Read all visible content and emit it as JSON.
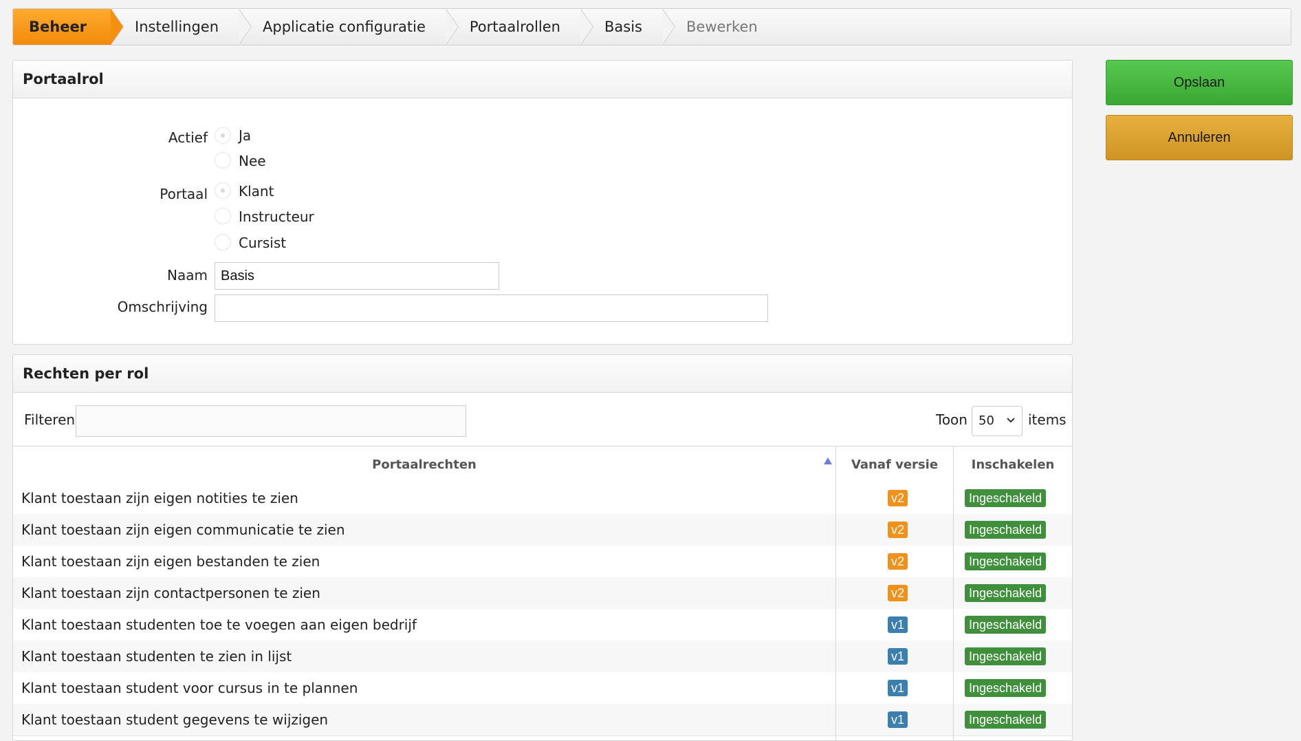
{
  "breadcrumb": [
    "Beheer",
    "Instellingen",
    "Applicatie configuratie",
    "Portaalrollen",
    "Basis",
    "Bewerken"
  ],
  "buttons": {
    "save": "Opslaan",
    "cancel": "Annuleren"
  },
  "form": {
    "title": "Portaalrol",
    "actief_label": "Actief",
    "actief_options": [
      "Ja",
      "Nee"
    ],
    "portaal_label": "Portaal",
    "portaal_options": [
      "Klant",
      "Instructeur",
      "Cursist"
    ],
    "naam_label": "Naam",
    "naam_value": "Basis",
    "omschrijving_label": "Omschrijving",
    "omschrijving_value": ""
  },
  "rights": {
    "title": "Rechten per rol",
    "filter_label": "Filteren",
    "filter_value": "",
    "show_label": "Toon",
    "show_value": "50",
    "items_label": "items",
    "columns": [
      "Portaalrechten",
      "Vanaf versie",
      "Inschakelen"
    ],
    "rows": [
      {
        "name": "Klant toestaan zijn eigen notities te zien",
        "version": "v2",
        "status": "Ingeschakeld"
      },
      {
        "name": "Klant toestaan zijn eigen communicatie te zien",
        "version": "v2",
        "status": "Ingeschakeld"
      },
      {
        "name": "Klant toestaan zijn eigen bestanden te zien",
        "version": "v2",
        "status": "Ingeschakeld"
      },
      {
        "name": "Klant toestaan zijn contactpersonen te zien",
        "version": "v2",
        "status": "Ingeschakeld"
      },
      {
        "name": "Klant toestaan studenten toe te voegen aan eigen bedrijf",
        "version": "v1",
        "status": "Ingeschakeld"
      },
      {
        "name": "Klant toestaan studenten te zien in lijst",
        "version": "v1",
        "status": "Ingeschakeld"
      },
      {
        "name": "Klant toestaan student voor cursus in te plannen",
        "version": "v1",
        "status": "Ingeschakeld"
      },
      {
        "name": "Klant toestaan student gegevens te wijzigen",
        "version": "v1",
        "status": "Ingeschakeld"
      }
    ]
  },
  "colors": {
    "v2": "#f0921a",
    "v1": "#3a7fb0",
    "enabled": "#3f8f3c",
    "save": "#45b53d",
    "cancel": "#d99e2f",
    "active_crumb": "#f7951a"
  }
}
